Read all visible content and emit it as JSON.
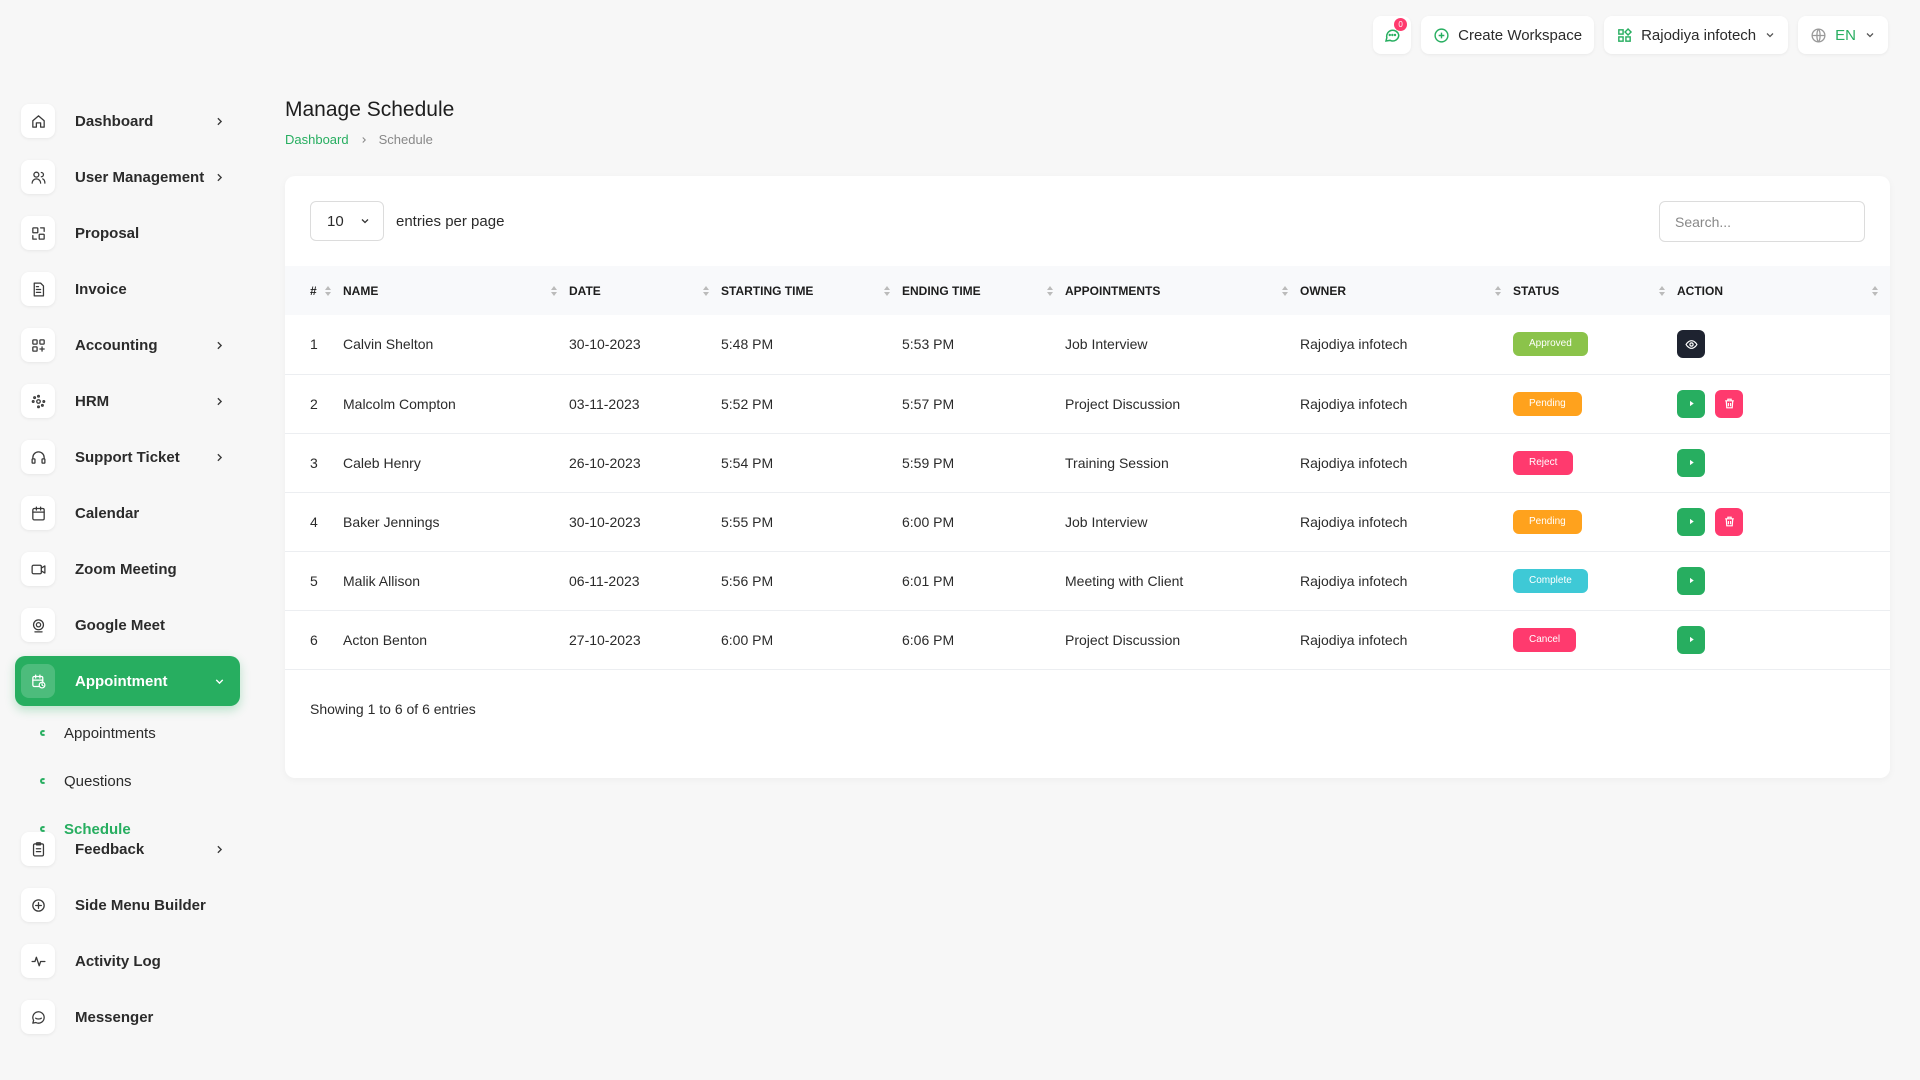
{
  "topbar": {
    "notification_count": "0",
    "create_workspace": "Create Workspace",
    "workspace_name": "Rajodiya infotech",
    "language": "EN"
  },
  "sidebar": {
    "items": [
      {
        "label": "Dashboard",
        "icon": "home-icon",
        "has_chevron": true
      },
      {
        "label": "User Management",
        "icon": "users-icon",
        "has_chevron": true
      },
      {
        "label": "Proposal",
        "icon": "proposal-icon",
        "has_chevron": false
      },
      {
        "label": "Invoice",
        "icon": "invoice-icon",
        "has_chevron": false
      },
      {
        "label": "Accounting",
        "icon": "accounting-icon",
        "has_chevron": true
      },
      {
        "label": "HRM",
        "icon": "hrm-icon",
        "has_chevron": true
      },
      {
        "label": "Support Ticket",
        "icon": "headset-icon",
        "has_chevron": true
      },
      {
        "label": "Calendar",
        "icon": "calendar-icon",
        "has_chevron": false
      },
      {
        "label": "Zoom Meeting",
        "icon": "video-icon",
        "has_chevron": false
      },
      {
        "label": "Google Meet",
        "icon": "meet-icon",
        "has_chevron": false
      },
      {
        "label": "Appointment",
        "icon": "calendar-clock-icon",
        "has_chevron": true,
        "active": true
      },
      {
        "label": "Feedback",
        "icon": "clipboard-icon",
        "has_chevron": true
      },
      {
        "label": "Side Menu Builder",
        "icon": "plus-circle-icon",
        "has_chevron": false
      },
      {
        "label": "Activity Log",
        "icon": "activity-icon",
        "has_chevron": false
      },
      {
        "label": "Messenger",
        "icon": "chat-icon",
        "has_chevron": false
      }
    ],
    "subitems": [
      {
        "label": "Appointments"
      },
      {
        "label": "Questions"
      },
      {
        "label": "Schedule",
        "active": true
      }
    ]
  },
  "header": {
    "title": "Manage Schedule",
    "breadcrumb_home": "Dashboard",
    "breadcrumb_current": "Schedule"
  },
  "table_controls": {
    "entries_value": "10",
    "entries_label": "entries per page",
    "search_placeholder": "Search..."
  },
  "columns": [
    "#",
    "NAME",
    "DATE",
    "STARTING TIME",
    "ENDING TIME",
    "APPOINTMENTS",
    "OWNER",
    "STATUS",
    "ACTION"
  ],
  "rows": [
    {
      "num": "1",
      "name": "Calvin Shelton",
      "date": "30-10-2023",
      "start": "5:48 PM",
      "end": "5:53 PM",
      "appointment": "Job Interview",
      "owner": "Rajodiya infotech",
      "status": "Approved",
      "status_color": "#8bc34a",
      "actions": [
        "view"
      ]
    },
    {
      "num": "2",
      "name": "Malcolm Compton",
      "date": "03-11-2023",
      "start": "5:52 PM",
      "end": "5:57 PM",
      "appointment": "Project Discussion",
      "owner": "Rajodiya infotech",
      "status": "Pending",
      "status_color": "#ffa21d",
      "actions": [
        "play",
        "delete"
      ]
    },
    {
      "num": "3",
      "name": "Caleb Henry",
      "date": "26-10-2023",
      "start": "5:54 PM",
      "end": "5:59 PM",
      "appointment": "Training Session",
      "owner": "Rajodiya infotech",
      "status": "Reject",
      "status_color": "#ff3a6e",
      "actions": [
        "play"
      ]
    },
    {
      "num": "4",
      "name": "Baker Jennings",
      "date": "30-10-2023",
      "start": "5:55 PM",
      "end": "6:00 PM",
      "appointment": "Job Interview",
      "owner": "Rajodiya infotech",
      "status": "Pending",
      "status_color": "#ffa21d",
      "actions": [
        "play",
        "delete"
      ]
    },
    {
      "num": "5",
      "name": "Malik Allison",
      "date": "06-11-2023",
      "start": "5:56 PM",
      "end": "6:01 PM",
      "appointment": "Meeting with Client",
      "owner": "Rajodiya infotech",
      "status": "Complete",
      "status_color": "#3ec9d6",
      "actions": [
        "play"
      ]
    },
    {
      "num": "6",
      "name": "Acton Benton",
      "date": "27-10-2023",
      "start": "6:00 PM",
      "end": "6:06 PM",
      "appointment": "Project Discussion",
      "owner": "Rajodiya infotech",
      "status": "Cancel",
      "status_color": "#ff3a6e",
      "actions": [
        "play"
      ]
    }
  ],
  "footer": {
    "showing": "Showing 1 to 6 of 6 entries"
  },
  "colors": {
    "accent": "#27ae60",
    "danger": "#ff3a6e",
    "dark": "#1e2330"
  }
}
